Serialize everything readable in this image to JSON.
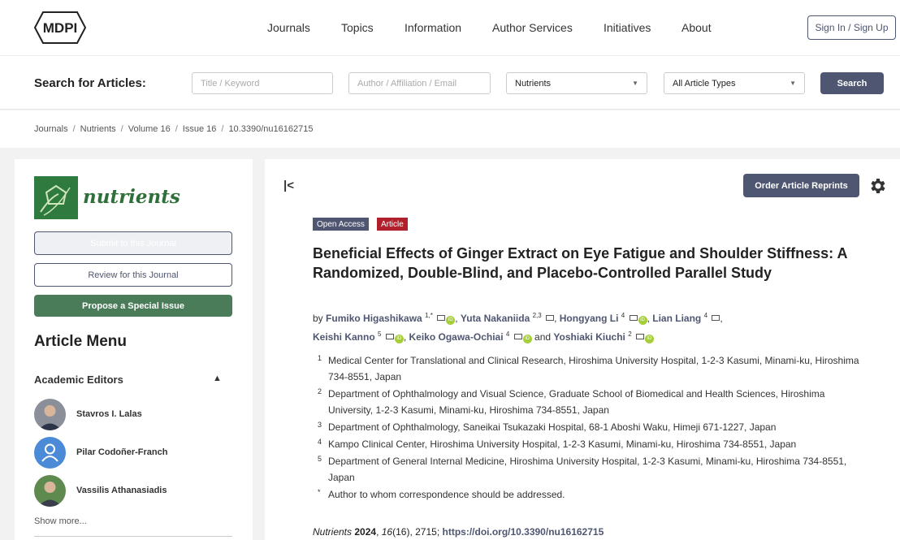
{
  "nav": {
    "logo": "MDPI",
    "items": [
      "Journals",
      "Topics",
      "Information",
      "Author Services",
      "Initiatives",
      "About"
    ],
    "signin": "Sign In / Sign Up"
  },
  "search": {
    "label": "Search for Articles:",
    "title_placeholder": "Title / Keyword",
    "author_placeholder": "Author / Affiliation / Email",
    "journal_selected": "Nutrients",
    "type_selected": "All Article Types",
    "button": "Search"
  },
  "breadcrumb": [
    "Journals",
    "Nutrients",
    "Volume 16",
    "Issue 16",
    "10.3390/nu16162715"
  ],
  "sidebar": {
    "journal_name": "nutrients",
    "submit": "Submit to this Journal",
    "review": "Review for this Journal",
    "propose": "Propose a Special Issue",
    "article_menu": "Article Menu",
    "academic_editors": "Academic Editors",
    "editors": [
      "Stavros I. Lalas",
      "Pilar Codoñer-Franch",
      "Vassilis Athanasiadis"
    ],
    "show_more": "Show more..."
  },
  "article": {
    "reprints": "Order Article Reprints",
    "badge_oa": "Open Access",
    "badge_type": "Article",
    "title": "Beneficial Effects of Ginger Extract on Eye Fatigue and Shoulder Stiffness: A Randomized, Double-Blind, and Placebo-Controlled Parallel Study",
    "by": "by",
    "and": "and",
    "authors": [
      {
        "name": "Fumiko Higashikawa",
        "sup": "1,*"
      },
      {
        "name": "Yuta Nakaniida",
        "sup": "2,3"
      },
      {
        "name": "Hongyang Li",
        "sup": "4"
      },
      {
        "name": "Lian Liang",
        "sup": "4"
      },
      {
        "name": "Keishi Kanno",
        "sup": "5"
      },
      {
        "name": "Keiko Ogawa-Ochiai",
        "sup": "4"
      },
      {
        "name": "Yoshiaki Kiuchi",
        "sup": "2"
      }
    ],
    "affiliations": [
      {
        "n": "1",
        "text": "Medical Center for Translational and Clinical Research, Hiroshima University Hospital, 1-2-3 Kasumi, Minami-ku, Hiroshima 734-8551, Japan"
      },
      {
        "n": "2",
        "text": "Department of Ophthalmology and Visual Science, Graduate School of Biomedical and Health Sciences, Hiroshima University, 1-2-3 Kasumi, Minami-ku, Hiroshima 734-8551, Japan"
      },
      {
        "n": "3",
        "text": "Department of Ophthalmology, Saneikai Tsukazaki Hospital, 68-1 Aboshi Waku, Himeji 671-1227, Japan"
      },
      {
        "n": "4",
        "text": "Kampo Clinical Center, Hiroshima University Hospital, 1-2-3 Kasumi, Minami-ku, Hiroshima 734-8551, Japan"
      },
      {
        "n": "5",
        "text": "Department of General Internal Medicine, Hiroshima University Hospital, 1-2-3 Kasumi, Minami-ku, Hiroshima 734-8551, Japan"
      },
      {
        "n": "*",
        "text": "Author to whom correspondence should be addressed."
      }
    ],
    "citation": {
      "journal": "Nutrients",
      "year": "2024",
      "volume": "16",
      "rest": "(16), 2715;",
      "doi": "https://doi.org/10.3390/nu16162715"
    }
  },
  "colors": {
    "accent": "#4f5671",
    "green": "#4a7c59",
    "red_badge": "#b0202c",
    "orcid": "#a6ce39"
  }
}
